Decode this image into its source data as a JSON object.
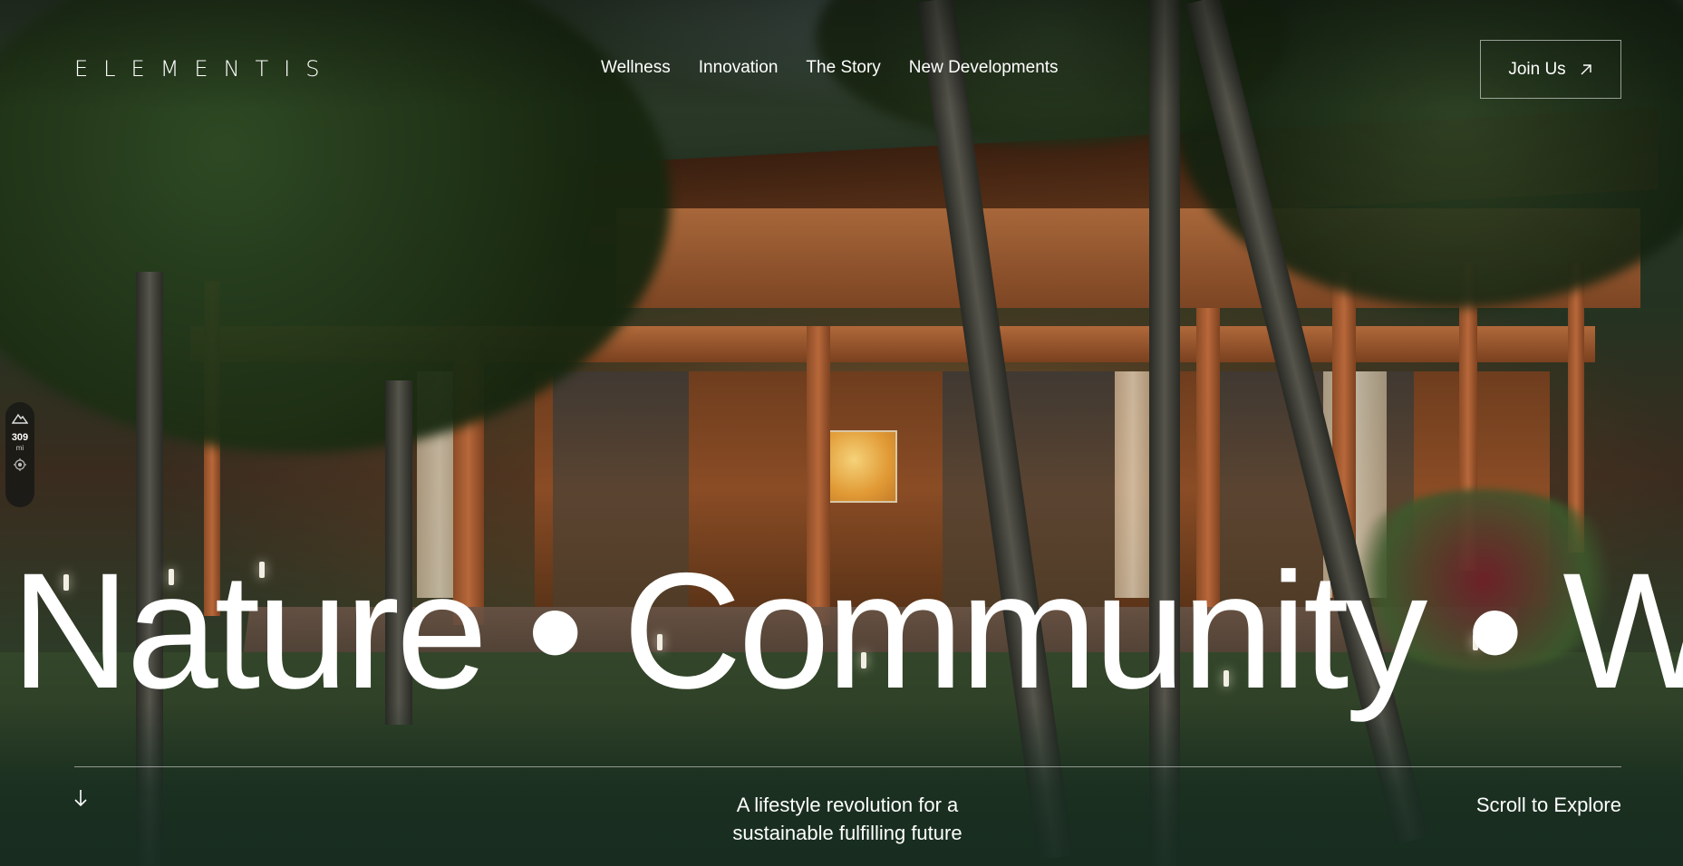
{
  "header": {
    "logo": "ELEMENTIS",
    "nav": [
      {
        "label": "Wellness"
      },
      {
        "label": "Innovation"
      },
      {
        "label": "The Story"
      },
      {
        "label": "New Developments"
      }
    ],
    "cta_label": "Join Us",
    "cta_icon": "arrow-up-right-icon"
  },
  "side_widget": {
    "icon_top": "mountain-icon",
    "value": "309",
    "unit": "mi",
    "icon_bottom": "location-target-icon"
  },
  "hero": {
    "text": "Nature • Community • W"
  },
  "footer": {
    "down_icon": "arrow-down-icon",
    "tagline_line1": "A lifestyle revolution for a",
    "tagline_line2": "sustainable fulfilling future",
    "scroll_label": "Scroll to Explore"
  },
  "colors": {
    "text": "#ffffff",
    "overlay": "#16301f"
  }
}
